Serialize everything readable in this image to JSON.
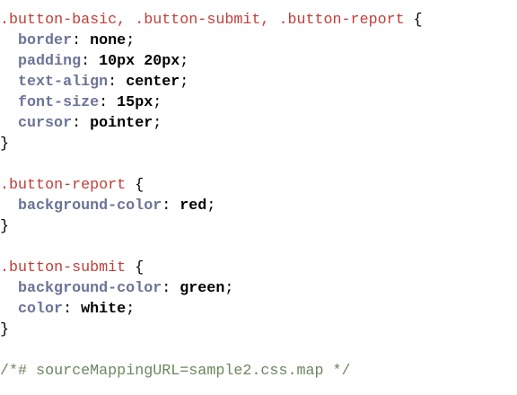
{
  "editor": {
    "lines": [
      {
        "kind": "selector",
        "selector": ".button-basic, .button-submit, .button-report",
        "tail": " {"
      },
      {
        "kind": "decl",
        "prop": "border",
        "value": "none"
      },
      {
        "kind": "decl",
        "prop": "padding",
        "value": "10px 20px"
      },
      {
        "kind": "decl",
        "prop": "text-align",
        "value": "center"
      },
      {
        "kind": "decl",
        "prop": "font-size",
        "value": "15px"
      },
      {
        "kind": "decl",
        "prop": "cursor",
        "value": "pointer"
      },
      {
        "kind": "close",
        "text": "}"
      },
      {
        "kind": "blank"
      },
      {
        "kind": "selector",
        "selector": ".button-report",
        "tail": " {"
      },
      {
        "kind": "decl",
        "prop": "background-color",
        "value": "red"
      },
      {
        "kind": "close",
        "text": "}"
      },
      {
        "kind": "blank"
      },
      {
        "kind": "selector",
        "selector": ".button-submit",
        "tail": " {"
      },
      {
        "kind": "decl",
        "prop": "background-color",
        "value": "green"
      },
      {
        "kind": "decl",
        "prop": "color",
        "value": "white"
      },
      {
        "kind": "close",
        "text": "}"
      },
      {
        "kind": "blank"
      },
      {
        "kind": "comment",
        "text": "/*# sourceMappingURL=sample2.css.map */"
      }
    ]
  },
  "colors": {
    "selector": "#c13e38",
    "property": "#6b7497",
    "value": "#000000",
    "comment": "#6a875d",
    "background": "#ffffff"
  }
}
